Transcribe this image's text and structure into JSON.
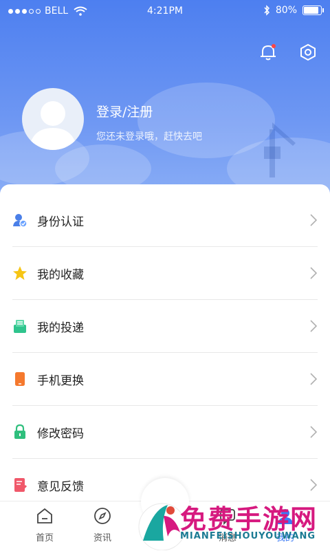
{
  "status_bar": {
    "carrier": "BELL",
    "time": "4:21PM",
    "battery": "80%"
  },
  "profile": {
    "title": "登录/注册",
    "subtitle": "您还未登录哦，赶快去吧"
  },
  "menu": {
    "items": [
      {
        "label": "身份认证",
        "icon": "id-verify-icon"
      },
      {
        "label": "我的收藏",
        "icon": "star-icon"
      },
      {
        "label": "我的投递",
        "icon": "delivery-icon"
      },
      {
        "label": "手机更换",
        "icon": "phone-icon"
      },
      {
        "label": "修改密码",
        "icon": "lock-icon"
      },
      {
        "label": "意见反馈",
        "icon": "feedback-icon"
      }
    ]
  },
  "tabs": [
    {
      "label": "首页"
    },
    {
      "label": "资讯"
    },
    {
      "label": "台"
    },
    {
      "label": "消息"
    },
    {
      "label": "我的"
    }
  ],
  "watermark": {
    "title": "免费手游网",
    "subtitle": "MIANFEISHOUYOUWANG"
  },
  "colors": {
    "accent": "#3b7af5",
    "header": "#5b8bf1"
  }
}
